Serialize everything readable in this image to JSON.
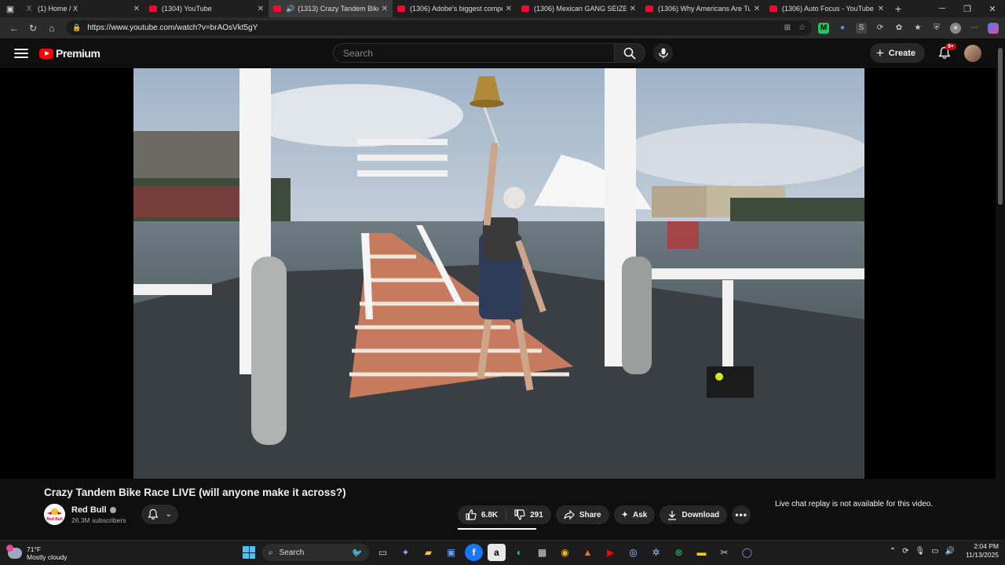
{
  "browser": {
    "tabs": [
      {
        "label": "(1) Home / X",
        "icon": "x-logo-icon",
        "active": false
      },
      {
        "label": "(1304) YouTube",
        "icon": "youtube-icon",
        "active": false
      },
      {
        "label": "(1313) Crazy Tandem Bike R...",
        "icon": "youtube-icon",
        "active": true
      },
      {
        "label": "(1306) Adobe's biggest competit...",
        "icon": "youtube-icon",
        "active": false
      },
      {
        "label": "(1306) Mexican GANG SEIZES LA...",
        "icon": "youtube-icon",
        "active": false
      },
      {
        "label": "(1306) Why Americans Are Turnin...",
        "icon": "youtube-icon",
        "active": false
      },
      {
        "label": "(1306) Auto Focus - YouTube",
        "icon": "youtube-icon",
        "active": false
      }
    ],
    "url": "https://www.youtube.com/watch?v=brAOsVkt5gY"
  },
  "youtube": {
    "logo_text": "Premium",
    "search_placeholder": "Search",
    "create_label": "Create",
    "notification_badge": "9+"
  },
  "video": {
    "title": "Crazy Tandem Bike Race LIVE (will anyone make it across?)",
    "channel_name": "Red Bull",
    "subscribers": "26.3M subscribers",
    "likes": "6.8K",
    "dislikes": "291",
    "share_label": "Share",
    "ask_label": "Ask",
    "download_label": "Download",
    "chat_note": "Live chat replay is not available for this video.",
    "channel_avatar_text": "Red Bull"
  },
  "taskbar": {
    "temperature": "71°F",
    "weather": "Mostly cloudy",
    "search_label": "Search",
    "time": "2:04 PM",
    "date": "11/13/2025"
  },
  "colors": {
    "accent": "#ff0000",
    "background": "#0f0f0f",
    "pill": "#272727"
  }
}
